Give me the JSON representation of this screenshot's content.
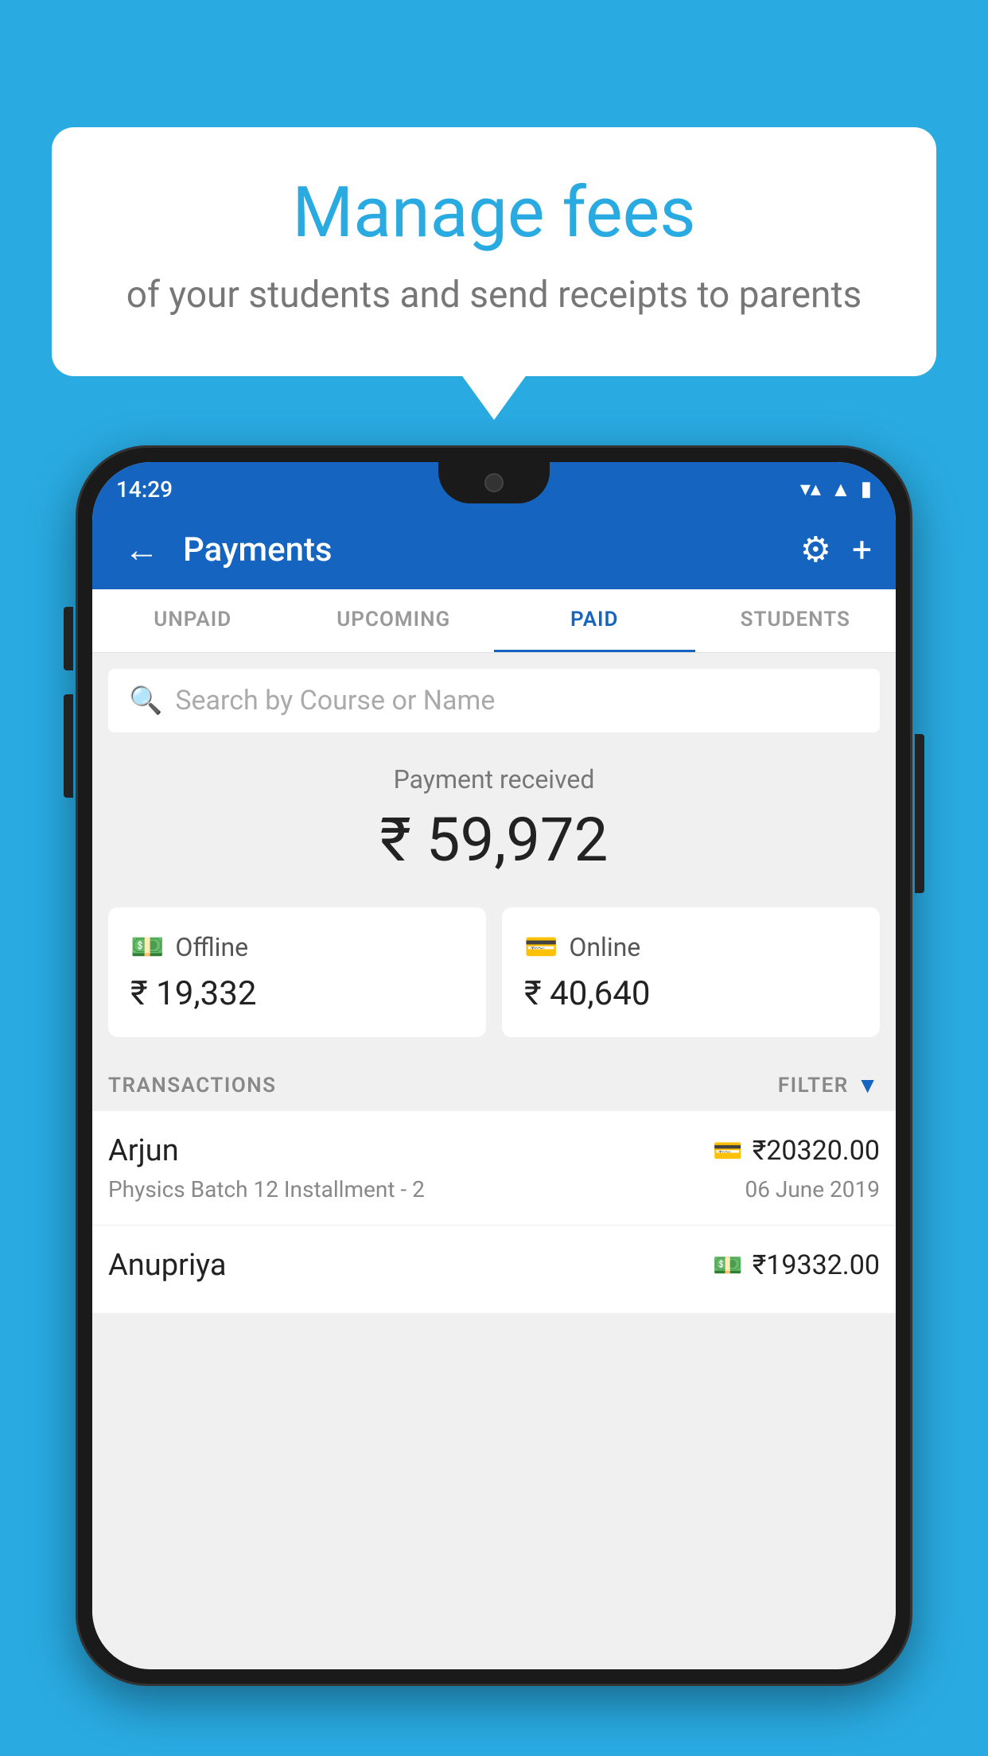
{
  "background_color": "#29ABE2",
  "speech_bubble": {
    "title": "Manage fees",
    "subtitle": "of your students and send receipts to parents"
  },
  "status_bar": {
    "time": "14:29",
    "wifi": "▼",
    "signal": "▲",
    "battery": "▮"
  },
  "app_bar": {
    "title": "Payments",
    "back_label": "←",
    "gear_label": "⚙",
    "plus_label": "+"
  },
  "tabs": [
    {
      "label": "UNPAID",
      "active": false
    },
    {
      "label": "UPCOMING",
      "active": false
    },
    {
      "label": "PAID",
      "active": true
    },
    {
      "label": "STUDENTS",
      "active": false
    }
  ],
  "search": {
    "placeholder": "Search by Course or Name"
  },
  "payment_summary": {
    "label": "Payment received",
    "amount": "₹ 59,972"
  },
  "payment_cards": [
    {
      "type": "Offline",
      "amount": "₹ 19,332",
      "icon": "💵"
    },
    {
      "type": "Online",
      "amount": "₹ 40,640",
      "icon": "💳"
    }
  ],
  "transactions_header": {
    "label": "TRANSACTIONS",
    "filter_label": "FILTER"
  },
  "transactions": [
    {
      "name": "Arjun",
      "course": "Physics Batch 12 Installment - 2",
      "amount": "₹20320.00",
      "date": "06 June 2019",
      "payment_type": "card"
    },
    {
      "name": "Anupriya",
      "course": "",
      "amount": "₹19332.00",
      "date": "",
      "payment_type": "cash"
    }
  ]
}
